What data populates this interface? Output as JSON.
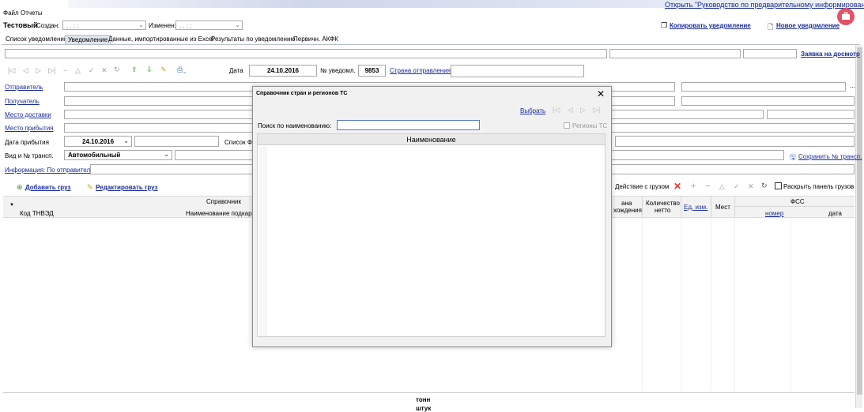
{
  "menu": {
    "file": "Файл",
    "reports": "Отчеты",
    "guide_link": "Открыть \"Руководство по предварительному информированию\""
  },
  "header": {
    "title": "Тестовый",
    "created_label": "Создан:",
    "created_value": ".    .       :   :",
    "changed_label": "Изменен:",
    "changed_value": ".    .       :   :",
    "copy_link": "Копировать уведомление",
    "new_link": "Новое уведомление"
  },
  "tabs": [
    "Список уведомлений",
    "Уведомление",
    "Данные, импортированные из Excel",
    "Результаты по уведомлению",
    "Первичн. АКФК"
  ],
  "topline": {
    "request_link": "Заявка на досмотр"
  },
  "toolbar": {
    "date_label": "Дата",
    "date_value": "24.10.2016",
    "notice_no_label": "№ уведомл.",
    "notice_no_value": "9853",
    "country_link": "Страна отправления"
  },
  "form": {
    "sender": "Отправитель",
    "receiver": "Получатель",
    "delivery_place": "Место доставки",
    "arrival_place": "Место прибытия",
    "arrival_date_label": "Дата прибытия",
    "arrival_date_value": "24.10.2016",
    "fss_list": "Список ФС",
    "transport_label": "Вид и № трансп.",
    "transport_value": "Автомобильный",
    "save_transport_link": "Сохранить № трансп.",
    "info_sender": "Информация: По отправителю",
    "ellipsis": "..."
  },
  "cargo": {
    "add": "Добавить груз",
    "edit": "Редактировать груз",
    "action_label": "Действие с грузом",
    "expand_label": "Раскрыть панель грузов"
  },
  "table": {
    "group_reference": "Справочник",
    "col_code": "Код ТНВЭД",
    "col_subcategory": "Наименование подкаран",
    "col_origin_line1": "ана",
    "col_origin_line2": "хождения",
    "col_qty_line1": "Количество",
    "col_qty_line2": "нетто",
    "col_unit": "Ед. изм.",
    "col_places": "Мест",
    "group_fss": "ФСС",
    "col_number": "номер",
    "col_date": "дата"
  },
  "footer": {
    "unit": "тонн",
    "unit2": "штук"
  },
  "dialog": {
    "title": "Справочник стран и регионов ТС",
    "select_link": "Выбрать",
    "search_label": "Поиск по наименованию:",
    "search_value": "",
    "regions_label": "Регионы ТС",
    "grid_header": "Наименование"
  },
  "colors": {
    "link": "#1a2c9a",
    "accent_red": "#d33",
    "badge": "#e05565"
  }
}
